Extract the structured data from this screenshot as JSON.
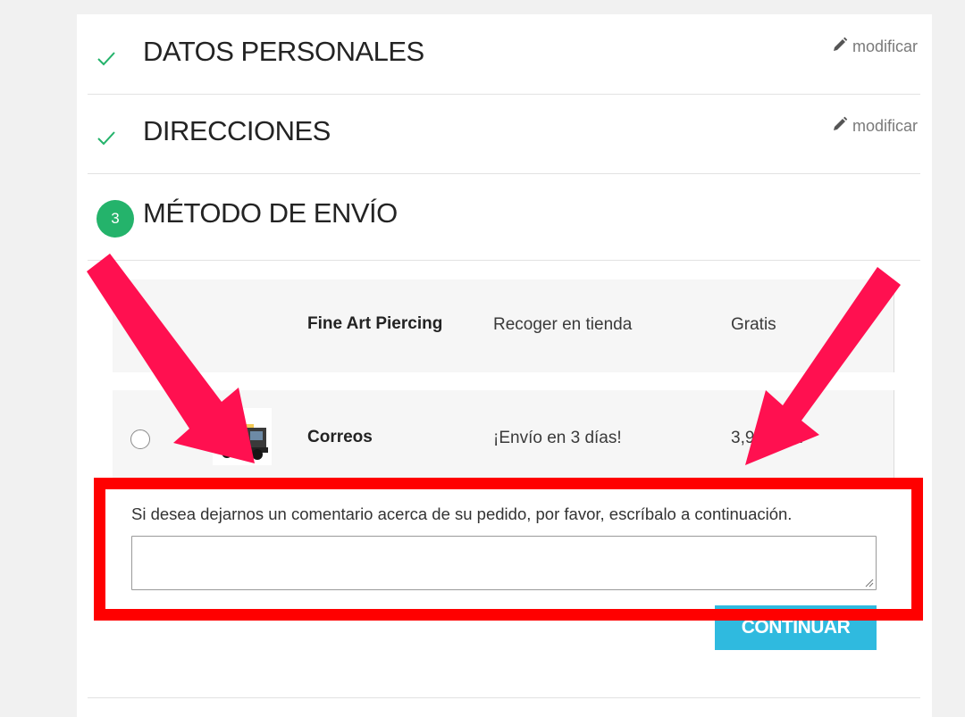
{
  "steps": [
    {
      "title": "DATOS PERSONALES",
      "modify_label": "modificar"
    },
    {
      "title": "DIRECCIONES",
      "modify_label": "modificar"
    },
    {
      "number": "3",
      "title": "MÉTODO DE ENVÍO"
    }
  ],
  "shipping_options": [
    {
      "carrier": "Fine Art Piercing",
      "delay": "Recoger en tienda",
      "price": "Gratis",
      "selected": true
    },
    {
      "carrier": "Correos",
      "delay": "¡Envío en 3 días!",
      "price": "3,9      p incl.",
      "selected": false,
      "icon": "truck-icon"
    }
  ],
  "comment": {
    "label": "Si desea dejarnos un comentario acerca de su pedido, por favor, escríbalo a continuación.",
    "value": ""
  },
  "continue_label": "CONTINUAR",
  "colors": {
    "accent_green": "#24b36b",
    "button_blue": "#2fbadf",
    "annotation_red": "#ff0000",
    "arrow_pink": "#ff1050"
  }
}
